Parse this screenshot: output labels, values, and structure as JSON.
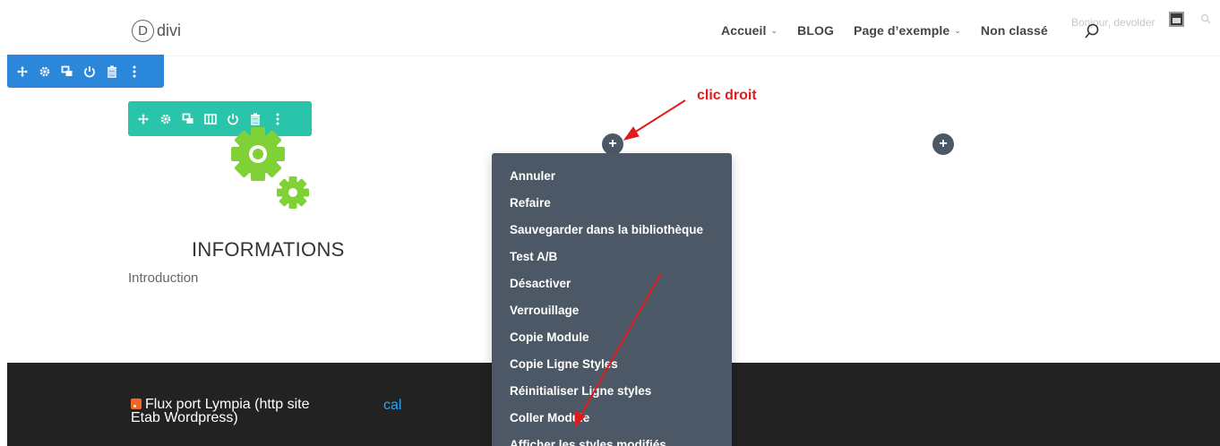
{
  "header": {
    "logo_letter": "D",
    "logo_text": "divi",
    "nav": [
      {
        "label": "Accueil",
        "dropdown": true
      },
      {
        "label": "BLOG",
        "dropdown": false
      },
      {
        "label": "Page d’exemple",
        "dropdown": true
      },
      {
        "label": "Non classé",
        "dropdown": false
      }
    ],
    "greeting": "Bonjour, devolder"
  },
  "section_toolbar": {
    "color": "#2b87da",
    "icons": [
      "move-icon",
      "settings-icon",
      "duplicate-icon",
      "power-icon",
      "trash-icon",
      "more-icon"
    ]
  },
  "row_toolbar": {
    "color": "#29c4a9",
    "icons": [
      "move-icon",
      "settings-icon",
      "duplicate-icon",
      "columns-icon",
      "power-icon",
      "trash-icon",
      "more-icon"
    ]
  },
  "content": {
    "title": "INFORMATIONS",
    "intro": "Introduction"
  },
  "annotation": {
    "text": "clic droit",
    "color": "#e01b1b"
  },
  "context_menu": {
    "items": [
      "Annuler",
      "Refaire",
      "Sauvegarder dans la bibliothèque",
      "Test A/B",
      "Désactiver",
      "Verrouillage",
      "Copie Module",
      "Copie Ligne Styles",
      "Réinitialiser Ligne styles",
      "Coller Module",
      "Afficher les styles modifiés"
    ]
  },
  "footer": {
    "feed_text": "Flux port Lympia (http site Etab Wordpress)",
    "cal_text": "cal"
  }
}
